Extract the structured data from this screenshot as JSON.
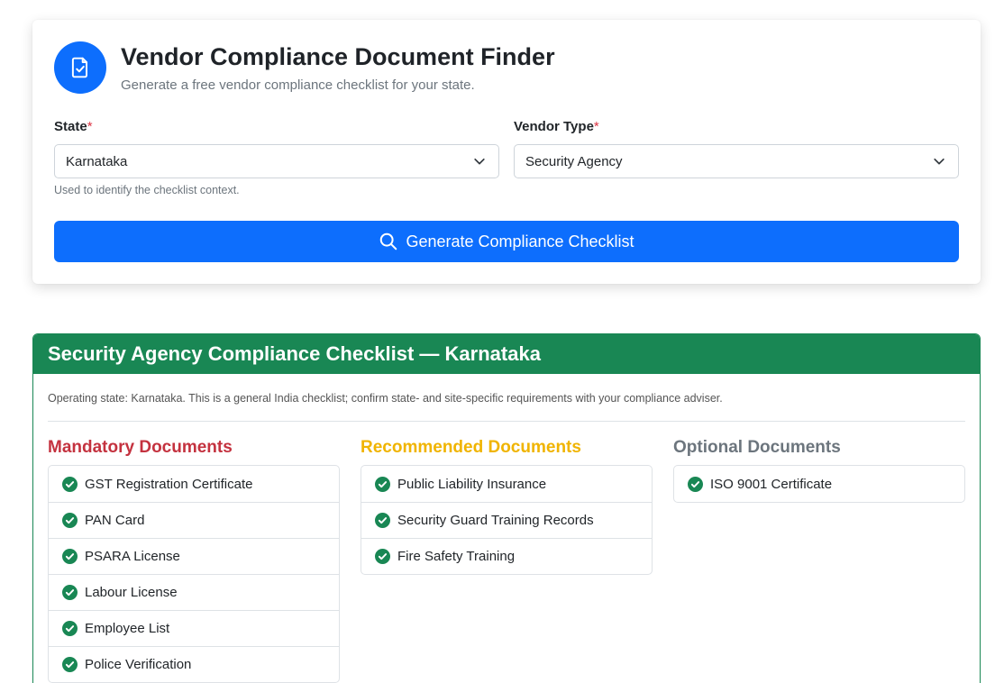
{
  "finder": {
    "title": "Vendor Compliance Document Finder",
    "subtitle": "Generate a free vendor compliance checklist for your state.",
    "header_icon": "file-check-icon",
    "state": {
      "label": "State",
      "required_mark": "*",
      "value": "Karnataka",
      "help": "Used to identify the checklist context."
    },
    "vendor_type": {
      "label": "Vendor Type",
      "required_mark": "*",
      "value": "Security Agency"
    },
    "generate_button": {
      "label": "Generate Compliance Checklist",
      "icon": "search-icon"
    }
  },
  "result": {
    "title": "Security Agency Compliance Checklist — Karnataka",
    "note": "Operating state: Karnataka. This is a general India checklist; confirm state- and site-specific requirements with your compliance adviser.",
    "columns": {
      "mandatory": {
        "title": "Mandatory Documents",
        "items": [
          "GST Registration Certificate",
          "PAN Card",
          "PSARA License",
          "Labour License",
          "Employee List",
          "Police Verification"
        ]
      },
      "recommended": {
        "title": "Recommended Documents",
        "items": [
          "Public Liability Insurance",
          "Security Guard Training Records",
          "Fire Safety Training"
        ]
      },
      "optional": {
        "title": "Optional Documents",
        "items": [
          "ISO 9001 Certificate"
        ]
      }
    }
  },
  "colors": {
    "primary": "#0d6efd",
    "success": "#198754",
    "mandatory": "#c4323f",
    "recommended": "#f0b400",
    "optional": "#6c757d",
    "required": "#dc3545"
  }
}
